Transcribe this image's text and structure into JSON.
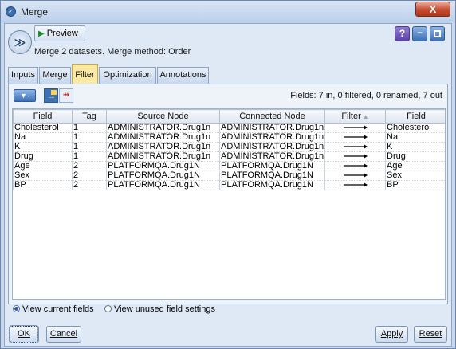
{
  "window": {
    "title": "Merge",
    "close_label": "X"
  },
  "toolbar": {
    "preview_label": "Preview",
    "help_label": "?",
    "minimize_label": "–"
  },
  "subtitle": "Merge 2 datasets. Merge method: Order",
  "tabs": [
    {
      "label": "Inputs",
      "active": false
    },
    {
      "label": "Merge",
      "active": false
    },
    {
      "label": "Filter",
      "active": true
    },
    {
      "label": "Optimization",
      "active": false
    },
    {
      "label": "Annotations",
      "active": false
    }
  ],
  "filter_toolbar": {
    "filter_button_label": "▼·",
    "fields_info": "Fields: 7 in, 0 filtered, 0 renamed, 7 out"
  },
  "table": {
    "headers": [
      "Field",
      "Tag",
      "Source Node",
      "Connected Node",
      "Filter",
      "Field"
    ],
    "rows": [
      {
        "field": "Cholesterol",
        "tag": "1",
        "source": "ADMINISTRATOR.Drug1n",
        "connected": "ADMINISTRATOR.Drug1n",
        "out_field": "Cholesterol"
      },
      {
        "field": "Na",
        "tag": "1",
        "source": "ADMINISTRATOR.Drug1n",
        "connected": "ADMINISTRATOR.Drug1n",
        "out_field": "Na"
      },
      {
        "field": "K",
        "tag": "1",
        "source": "ADMINISTRATOR.Drug1n",
        "connected": "ADMINISTRATOR.Drug1n",
        "out_field": "K"
      },
      {
        "field": "Drug",
        "tag": "1",
        "source": "ADMINISTRATOR.Drug1n",
        "connected": "ADMINISTRATOR.Drug1n",
        "out_field": "Drug"
      },
      {
        "field": "Age",
        "tag": "2",
        "source": "PLATFORMQA.Drug1N",
        "connected": "PLATFORMQA.Drug1N",
        "out_field": "Age"
      },
      {
        "field": "Sex",
        "tag": "2",
        "source": "PLATFORMQA.Drug1N",
        "connected": "PLATFORMQA.Drug1N",
        "out_field": "Sex"
      },
      {
        "field": "BP",
        "tag": "2",
        "source": "PLATFORMQA.Drug1N",
        "connected": "PLATFORMQA.Drug1N",
        "out_field": "BP"
      }
    ]
  },
  "view_options": {
    "current_fields_label": "View current fields",
    "current_fields_selected": true,
    "unused_settings_label": "View unused field settings",
    "unused_settings_selected": false
  },
  "footer": {
    "ok_label": "OK",
    "cancel_label": "Cancel",
    "apply_label": "Apply",
    "reset_label": "Reset"
  },
  "colors": {
    "active_tab": "#fbe9a4",
    "window_frame": "#c9d9ee",
    "close_button": "#c44b30"
  }
}
